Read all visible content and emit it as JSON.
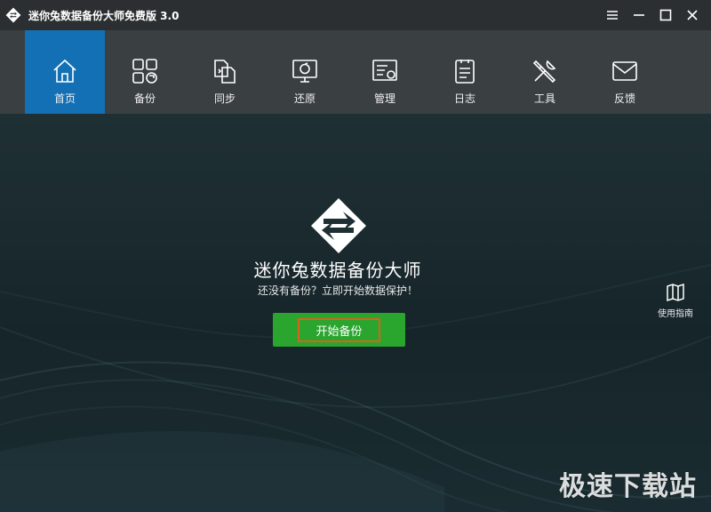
{
  "window": {
    "title": "迷你兔数据备份大师免费版 3.0",
    "controls": [
      "menu",
      "minimize",
      "maximize",
      "close"
    ]
  },
  "nav": {
    "items": [
      {
        "label": "首页",
        "icon": "home-icon",
        "active": true
      },
      {
        "label": "备份",
        "icon": "backup-grid-icon",
        "active": false
      },
      {
        "label": "同步",
        "icon": "sync-files-icon",
        "active": false
      },
      {
        "label": "还原",
        "icon": "restore-monitor-icon",
        "active": false
      },
      {
        "label": "管理",
        "icon": "manage-settings-icon",
        "active": false
      },
      {
        "label": "日志",
        "icon": "log-clipboard-icon",
        "active": false
      },
      {
        "label": "工具",
        "icon": "tools-icon",
        "active": false
      },
      {
        "label": "反馈",
        "icon": "feedback-mail-icon",
        "active": false
      }
    ]
  },
  "main": {
    "title": "迷你兔数据备份大师",
    "subtitle": "还没有备份？立即开始数据保护！",
    "start_button": "开始备份",
    "guide_label": "使用指南"
  },
  "watermark": "极速下载站",
  "colors": {
    "titlebar": "#2b2f31",
    "navbar": "#3a3f42",
    "active_tab": "#1470b4",
    "button_green": "#2aa52e",
    "button_focus_border": "#d9621d",
    "background": "#1b2a2e"
  }
}
